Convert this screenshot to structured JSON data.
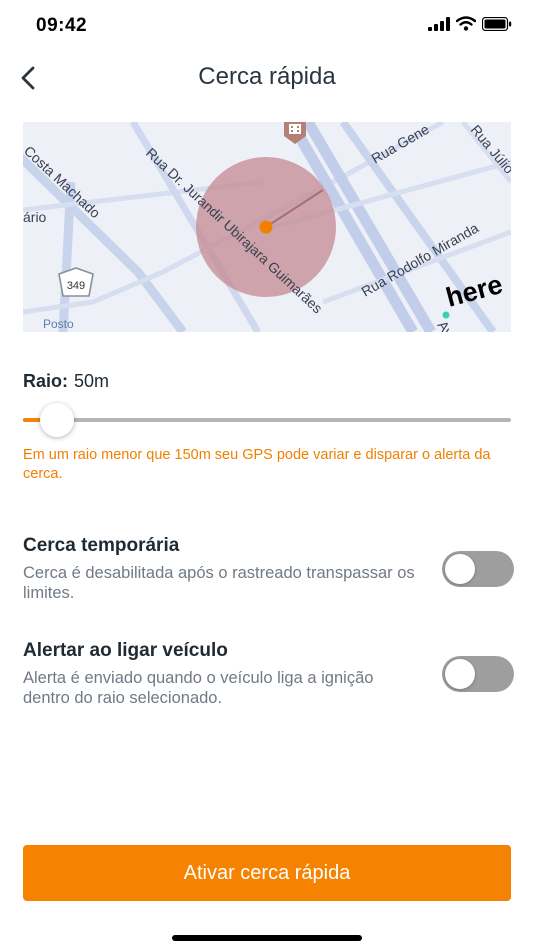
{
  "status_bar": {
    "time": "09:42"
  },
  "header": {
    "title": "Cerca rápida",
    "back_icon": "chevron-left-icon"
  },
  "map": {
    "streets": [
      "Rua Dr. Jurandir Ubirajara Guimarães",
      "Costa Machado",
      "Rua Gene",
      "Rua Júlio",
      "Rua Rodolfo Miranda",
      "ário",
      "Posto",
      "Aven"
    ],
    "route_badge": "349",
    "provider": "here",
    "colors": {
      "background": "#eef0f7",
      "road": "#c8d3ec",
      "geofence": "#c48a92",
      "center": "#f08000"
    }
  },
  "radius": {
    "label": "Raio:",
    "value": "50m",
    "slider_fraction": 0.04
  },
  "warning": "Em um raio menor que 150m seu GPS pode variar e disparar o alerta da cerca.",
  "options": [
    {
      "title": "Cerca temporária",
      "description": "Cerca é desabilitada após o rastreado transpassar os limites.",
      "enabled": false
    },
    {
      "title": "Alertar ao ligar veículo",
      "description": "Alerta é enviado quando o veículo liga a ignição dentro do raio selecionado.",
      "enabled": false
    }
  ],
  "action_button": {
    "label": "Ativar cerca rápida"
  },
  "colors": {
    "accent": "#f58200",
    "warning": "#f08000",
    "toggle_off": "#9e9e9e"
  }
}
